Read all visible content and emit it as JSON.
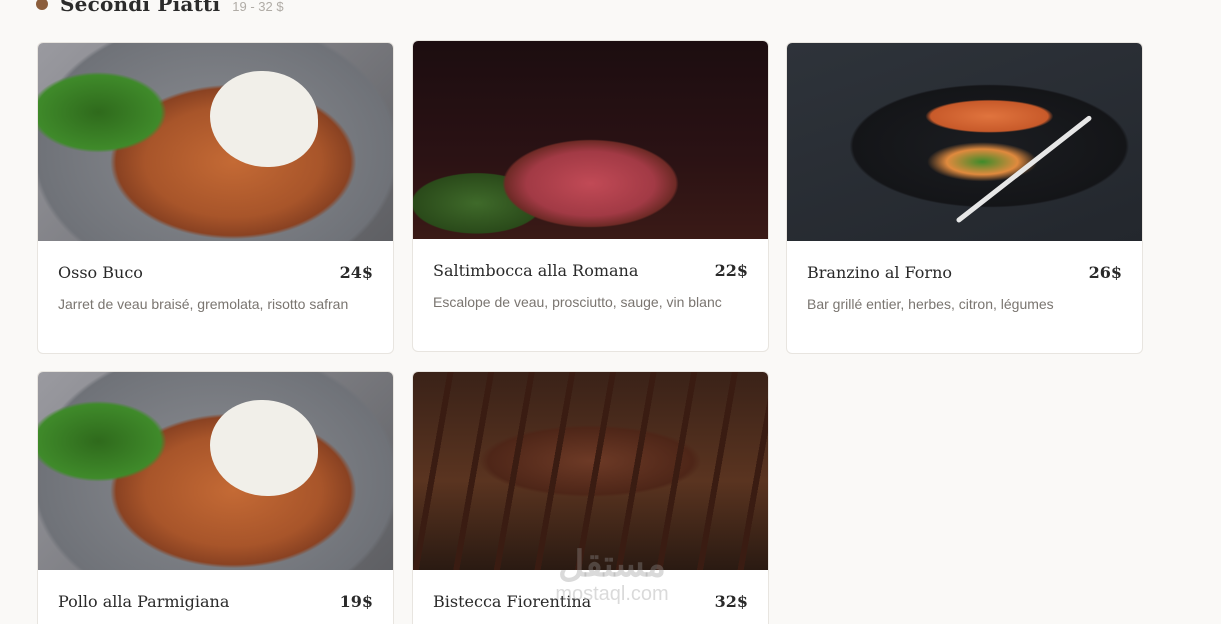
{
  "section": {
    "title": "Secondi Piatti",
    "range": "19 - 32 $"
  },
  "cards": [
    {
      "name": "Osso Buco",
      "price": "24$",
      "desc": "Jarret de veau braisé, gremolata, risotto safran",
      "image": "osso-buco-photo"
    },
    {
      "name": "Saltimbocca alla Romana",
      "price": "22$",
      "desc": "Escalope de veau, prosciutto, sauge, vin blanc",
      "image": "saltimbocca-photo"
    },
    {
      "name": "Branzino al Forno",
      "price": "26$",
      "desc": "Bar grillé entier, herbes, citron, légumes",
      "image": "branzino-photo"
    },
    {
      "name": "Pollo alla Parmigiana",
      "price": "19$",
      "desc": "",
      "image": "pollo-parmigiana-photo"
    },
    {
      "name": "Bistecca Fiorentina",
      "price": "32$",
      "desc": "",
      "image": "bistecca-photo"
    }
  ],
  "watermark": {
    "arabic": "مستقل",
    "latin": "mostaql.com"
  },
  "colors": {
    "accent_dot": "#8b5e3c",
    "background": "#faf9f7"
  }
}
